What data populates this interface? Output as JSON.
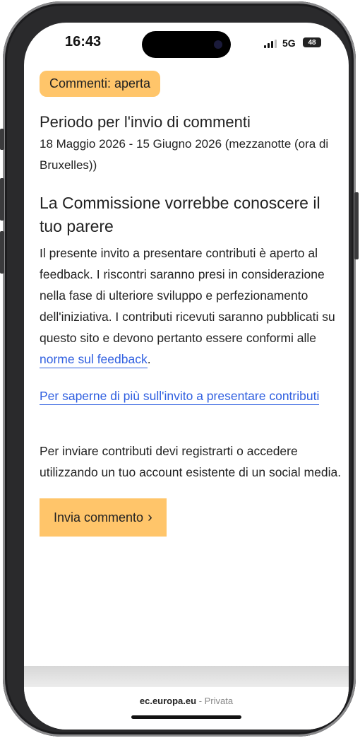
{
  "status_bar": {
    "time": "16:43",
    "network": "5G",
    "battery": "48"
  },
  "content": {
    "status_badge": "Commenti: aperta",
    "period_title": "Periodo per l'invio di commenti",
    "period_dates": "18 Maggio 2026 - 15 Giugno 2026  (mezzanotte (ora di Bruxelles))",
    "heading": "La Commissione vorrebbe conoscere il tuo parere",
    "paragraph_text": "Il presente invito a presentare contributi è aperto al feedback. I riscontri saranno presi in considerazione nella fase di ulteriore sviluppo e perfezionamento dell'iniziativa. I contributi ricevuti saranno pubblicati su questo sito e devono pertanto essere conformi alle ",
    "paragraph_link": "norme sul feedback",
    "paragraph_end": ".",
    "more_link": "Per saperne di più sull'invito a presentare contributi",
    "register_text": "Per inviare contributi devi registrarti o accedere utilizzando un tuo account esistente di un social media.",
    "submit_label": "Invia commento"
  },
  "browser": {
    "domain": "ec.europa.eu",
    "separator": " - ",
    "privacy": "Privata"
  },
  "colors": {
    "accent_orange": "#ffc56a",
    "link_blue": "#2f5fe0"
  }
}
